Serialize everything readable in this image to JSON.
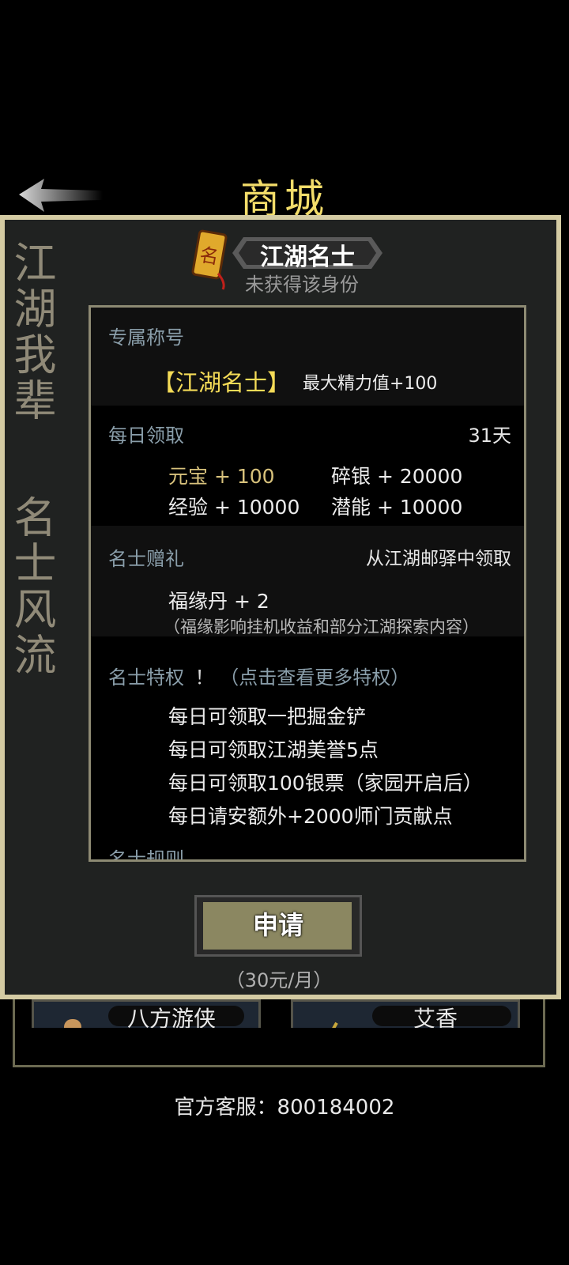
{
  "header": {
    "title": "商城",
    "back_icon": "back-arrow-icon"
  },
  "side_text": {
    "left_top": "江湖我辈",
    "left_bottom": "名士风流"
  },
  "identity": {
    "badge_icon": "scroll-badge-icon",
    "title": "江湖名士",
    "status": "未获得该身份"
  },
  "sections": {
    "title": {
      "label": "专属称号",
      "name": "【江湖名士】",
      "effect": "最大精力值+100"
    },
    "daily": {
      "label": "每日领取",
      "duration": "31天",
      "rewards": [
        "元宝 + 100",
        "碎银 + 20000",
        "经验 + 10000",
        "潜能 + 10000"
      ]
    },
    "gift": {
      "label": "名士赠礼",
      "source": "从江湖邮驿中领取",
      "item": "福缘丹 + 2",
      "note": "（福缘影响挂机收益和部分江湖探索内容）"
    },
    "privilege": {
      "label": "名士特权",
      "exclaim": "！",
      "hint": "（点击查看更多特权）",
      "items": [
        "每日可领取一把掘金铲",
        "每日可领取江湖美誉5点",
        "每日可领取100银票（家园开启后）",
        "每日请安额外+2000师门贡献点"
      ]
    },
    "rules": {
      "label": "名士规则"
    }
  },
  "apply": {
    "label": "申请",
    "price": "（30元/月）"
  },
  "background": {
    "cards": [
      "八方游侠",
      "艾香"
    ],
    "service": "官方客服：800184002"
  },
  "colors": {
    "title_gold": "#f3dd6a",
    "frame": "#d4cba3",
    "button": "#8b8761",
    "section": "#8a9eaa"
  }
}
